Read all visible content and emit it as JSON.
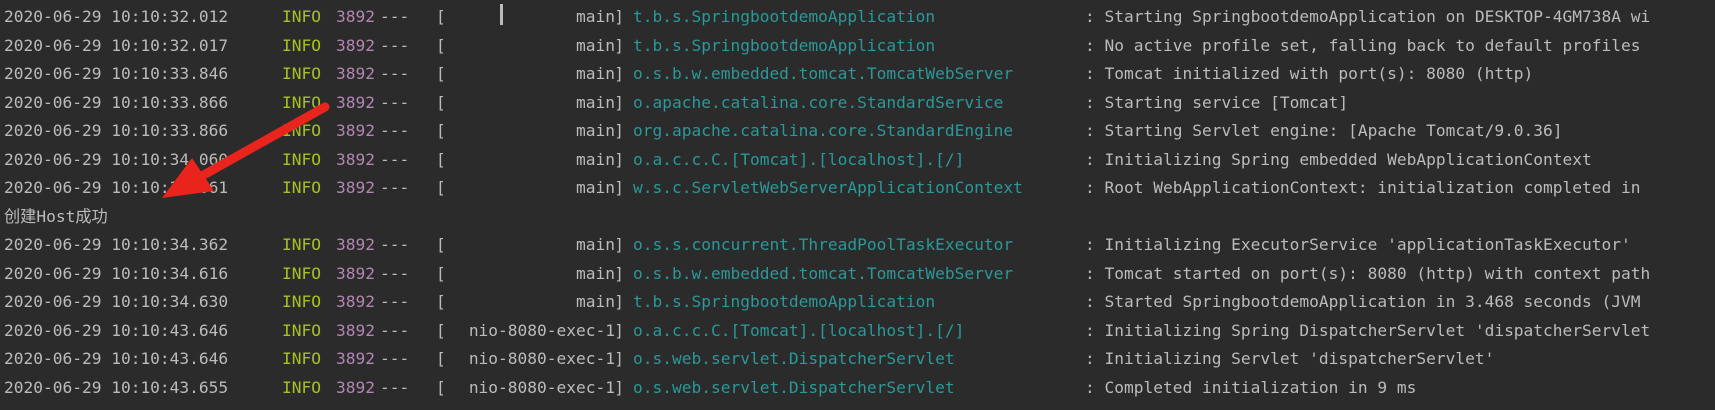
{
  "colors": {
    "background": "#2b2b2b",
    "text": "#bbbbbb",
    "level_info": "#a8c023",
    "pid": "#b386b3",
    "logger": "#299999",
    "annotation_arrow": "#e8241c"
  },
  "annotation": {
    "icon": "red-arrow-icon"
  },
  "lines": [
    {
      "timestamp": "2020-06-29 10:10:32.012",
      "level": "INFO",
      "pid": "3892",
      "sep": "---",
      "thread": "main",
      "logger": "t.b.s.SpringbootdemoApplication",
      "message": ": Starting SpringbootdemoApplication on DESKTOP-4GM738A wi"
    },
    {
      "timestamp": "2020-06-29 10:10:32.017",
      "level": "INFO",
      "pid": "3892",
      "sep": "---",
      "thread": "main",
      "logger": "t.b.s.SpringbootdemoApplication",
      "message": ": No active profile set, falling back to default profiles"
    },
    {
      "timestamp": "2020-06-29 10:10:33.846",
      "level": "INFO",
      "pid": "3892",
      "sep": "---",
      "thread": "main",
      "logger": "o.s.b.w.embedded.tomcat.TomcatWebServer",
      "message": ": Tomcat initialized with port(s): 8080 (http)"
    },
    {
      "timestamp": "2020-06-29 10:10:33.866",
      "level": "INFO",
      "pid": "3892",
      "sep": "---",
      "thread": "main",
      "logger": "o.apache.catalina.core.StandardService",
      "message": ": Starting service [Tomcat]"
    },
    {
      "timestamp": "2020-06-29 10:10:33.866",
      "level": "INFO",
      "pid": "3892",
      "sep": "---",
      "thread": "main",
      "logger": "org.apache.catalina.core.StandardEngine",
      "message": ": Starting Servlet engine: [Apache Tomcat/9.0.36]"
    },
    {
      "timestamp": "2020-06-29 10:10:34.060",
      "level": "INFO",
      "pid": "3892",
      "sep": "---",
      "thread": "main",
      "logger": "o.a.c.c.C.[Tomcat].[localhost].[/]",
      "message": ": Initializing Spring embedded WebApplicationContext"
    },
    {
      "timestamp": "2020-06-29 10:10:34.061",
      "level": "INFO",
      "pid": "3892",
      "sep": "---",
      "thread": "main",
      "logger": "w.s.c.ServletWebServerApplicationContext",
      "message": ": Root WebApplicationContext: initialization completed in"
    },
    {
      "plain": "创建Host成功"
    },
    {
      "timestamp": "2020-06-29 10:10:34.362",
      "level": "INFO",
      "pid": "3892",
      "sep": "---",
      "thread": "main",
      "logger": "o.s.s.concurrent.ThreadPoolTaskExecutor",
      "message": ": Initializing ExecutorService 'applicationTaskExecutor'"
    },
    {
      "timestamp": "2020-06-29 10:10:34.616",
      "level": "INFO",
      "pid": "3892",
      "sep": "---",
      "thread": "main",
      "logger": "o.s.b.w.embedded.tomcat.TomcatWebServer",
      "message": ": Tomcat started on port(s): 8080 (http) with context path"
    },
    {
      "timestamp": "2020-06-29 10:10:34.630",
      "level": "INFO",
      "pid": "3892",
      "sep": "---",
      "thread": "main",
      "logger": "t.b.s.SpringbootdemoApplication",
      "message": ": Started SpringbootdemoApplication in 3.468 seconds (JVM"
    },
    {
      "timestamp": "2020-06-29 10:10:43.646",
      "level": "INFO",
      "pid": "3892",
      "sep": "---",
      "thread": "nio-8080-exec-1",
      "logger": "o.a.c.c.C.[Tomcat].[localhost].[/]",
      "message": ": Initializing Spring DispatcherServlet 'dispatcherServlet"
    },
    {
      "timestamp": "2020-06-29 10:10:43.646",
      "level": "INFO",
      "pid": "3892",
      "sep": "---",
      "thread": "nio-8080-exec-1",
      "logger": "o.s.web.servlet.DispatcherServlet",
      "message": ": Initializing Servlet 'dispatcherServlet'"
    },
    {
      "timestamp": "2020-06-29 10:10:43.655",
      "level": "INFO",
      "pid": "3892",
      "sep": "---",
      "thread": "nio-8080-exec-1",
      "logger": "o.s.web.servlet.DispatcherServlet",
      "message": ": Completed initialization in 9 ms"
    }
  ]
}
